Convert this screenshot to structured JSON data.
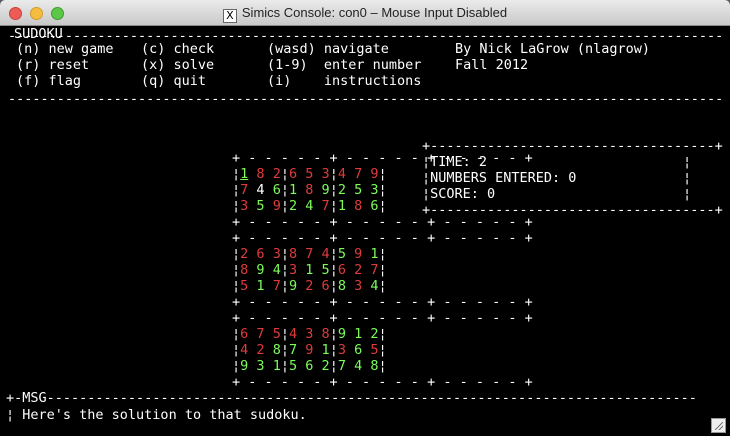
{
  "window": {
    "title": "Simics Console: con0 – Mouse Input Disabled",
    "x_icon": "X"
  },
  "header": {
    "app_title": "SUDOKU",
    "row1": {
      "c1": "(n) new game",
      "c2": "(c) check",
      "c3": "(wasd) navigate",
      "c4": "By Nick LaGrow (nlagrow)"
    },
    "row2": {
      "c1": "(r) reset",
      "c2": "(x) solve",
      "c3": "(1-9)  enter number",
      "c4": "Fall 2012"
    },
    "row3": {
      "c1": "(f) flag",
      "c2": "(q) quit",
      "c3": "(i)    instructions"
    }
  },
  "board": {
    "rows": [
      [
        "1",
        "8",
        "2",
        "6",
        "5",
        "3",
        "4",
        "7",
        "9"
      ],
      [
        "7",
        "4",
        "6",
        "1",
        "8",
        "9",
        "2",
        "5",
        "3"
      ],
      [
        "3",
        "5",
        "9",
        "2",
        "4",
        "7",
        "1",
        "8",
        "6"
      ],
      [
        "2",
        "6",
        "3",
        "8",
        "7",
        "4",
        "5",
        "9",
        "1"
      ],
      [
        "8",
        "9",
        "4",
        "3",
        "1",
        "5",
        "6",
        "2",
        "7"
      ],
      [
        "5",
        "1",
        "7",
        "9",
        "2",
        "6",
        "8",
        "3",
        "4"
      ],
      [
        "6",
        "7",
        "5",
        "4",
        "3",
        "8",
        "9",
        "1",
        "2"
      ],
      [
        "4",
        "2",
        "8",
        "7",
        "9",
        "1",
        "3",
        "6",
        "5"
      ],
      [
        "9",
        "3",
        "1",
        "5",
        "6",
        "2",
        "7",
        "4",
        "8"
      ]
    ],
    "colors": [
      [
        "g",
        "r",
        "r",
        "r",
        "r",
        "r",
        "r",
        "r",
        "r"
      ],
      [
        "r",
        "w",
        "g",
        "g",
        "r",
        "g",
        "g",
        "g",
        "g"
      ],
      [
        "r",
        "g",
        "r",
        "g",
        "g",
        "r",
        "g",
        "r",
        "g"
      ],
      [
        "r",
        "r",
        "r",
        "r",
        "r",
        "r",
        "g",
        "r",
        "g"
      ],
      [
        "r",
        "g",
        "g",
        "r",
        "g",
        "g",
        "r",
        "r",
        "r"
      ],
      [
        "r",
        "g",
        "r",
        "g",
        "r",
        "r",
        "g",
        "r",
        "g"
      ],
      [
        "r",
        "r",
        "r",
        "r",
        "r",
        "r",
        "g",
        "g",
        "g"
      ],
      [
        "r",
        "r",
        "g",
        "g",
        "r",
        "g",
        "r",
        "g",
        "r"
      ],
      [
        "g",
        "g",
        "g",
        "g",
        "g",
        "g",
        "g",
        "g",
        "g"
      ]
    ],
    "cursor": [
      0,
      0
    ],
    "color_values": {
      "g": "#7cfc5c",
      "r": "#e03b3b",
      "w": "#ffffff"
    }
  },
  "stats": {
    "time": "TIME: 2",
    "numbers_entered": "NUMBERS ENTERED: 0",
    "score": "SCORE: 0"
  },
  "msg": {
    "label": "MSG",
    "text": "Here's the solution to that sudoku."
  }
}
